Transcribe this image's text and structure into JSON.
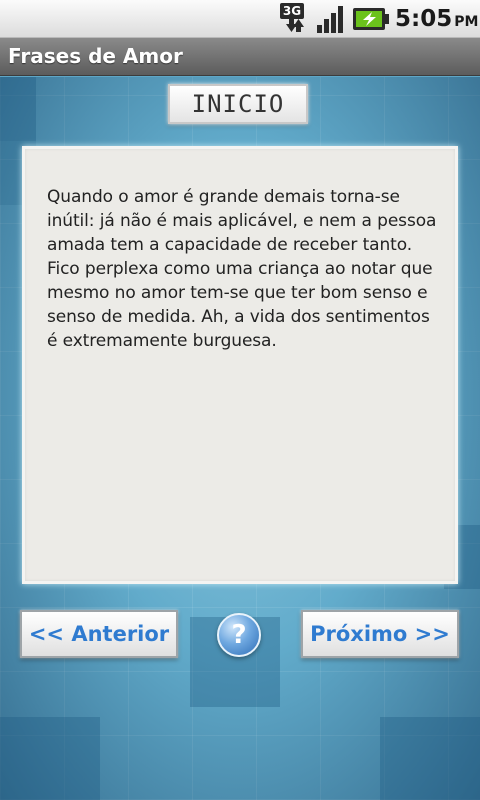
{
  "status_bar": {
    "network_label": "3G",
    "time": "5:05",
    "ampm": "PM",
    "icons": [
      "network-3g-icon",
      "signal-strength-icon",
      "battery-charging-icon"
    ]
  },
  "app": {
    "title": "Frases de Amor"
  },
  "header": {
    "inicio_label": "INICIO"
  },
  "quote": {
    "text": "Quando o amor é grande demais torna-se inútil: já não é mais aplicável, e nem a pessoa amada tem a capacidade de receber tanto. Fico perplexa como uma criança ao notar que mesmo no amor tem-se que ter bom senso e senso de medida. Ah, a vida dos sentimentos é extremamente burguesa."
  },
  "navigation": {
    "prev_label": "<< Anterior",
    "help_label": "?",
    "next_label": "Próximo >>"
  },
  "colors": {
    "accent": "#2f7bd0",
    "background": "#5ea9c9",
    "panel": "#ecebe7"
  }
}
